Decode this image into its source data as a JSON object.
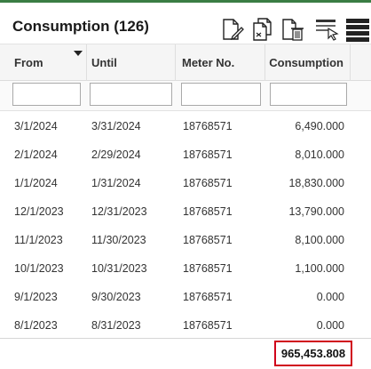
{
  "header": {
    "title": "Consumption (126)"
  },
  "toolbar": {
    "buttons": [
      {
        "name": "edit-document-icon"
      },
      {
        "name": "copy-document-icon"
      },
      {
        "name": "delete-document-icon"
      },
      {
        "name": "column-chooser-icon"
      },
      {
        "name": "menu-icon"
      }
    ]
  },
  "columns": [
    "From",
    "Until",
    "Meter No.",
    "Consumption"
  ],
  "sort": {
    "column": "From",
    "direction": "descending"
  },
  "filters": {
    "from": "",
    "until": "",
    "meter_no": "",
    "consumption": ""
  },
  "rows": [
    {
      "from": "3/1/2024",
      "until": "3/31/2024",
      "meter": "18768571",
      "consumption": "6,490.000"
    },
    {
      "from": "2/1/2024",
      "until": "2/29/2024",
      "meter": "18768571",
      "consumption": "8,010.000"
    },
    {
      "from": "1/1/2024",
      "until": "1/31/2024",
      "meter": "18768571",
      "consumption": "18,830.000"
    },
    {
      "from": "12/1/2023",
      "until": "12/31/2023",
      "meter": "18768571",
      "consumption": "13,790.000"
    },
    {
      "from": "11/1/2023",
      "until": "11/30/2023",
      "meter": "18768571",
      "consumption": "8,100.000"
    },
    {
      "from": "10/1/2023",
      "until": "10/31/2023",
      "meter": "18768571",
      "consumption": "1,100.000"
    },
    {
      "from": "9/1/2023",
      "until": "9/30/2023",
      "meter": "18768571",
      "consumption": "0.000"
    },
    {
      "from": "8/1/2023",
      "until": "8/31/2023",
      "meter": "18768571",
      "consumption": "0.000"
    }
  ],
  "footer": {
    "total": "965,453.808"
  },
  "colors": {
    "accent": "#3a7d44",
    "highlight": "#d0021b"
  }
}
